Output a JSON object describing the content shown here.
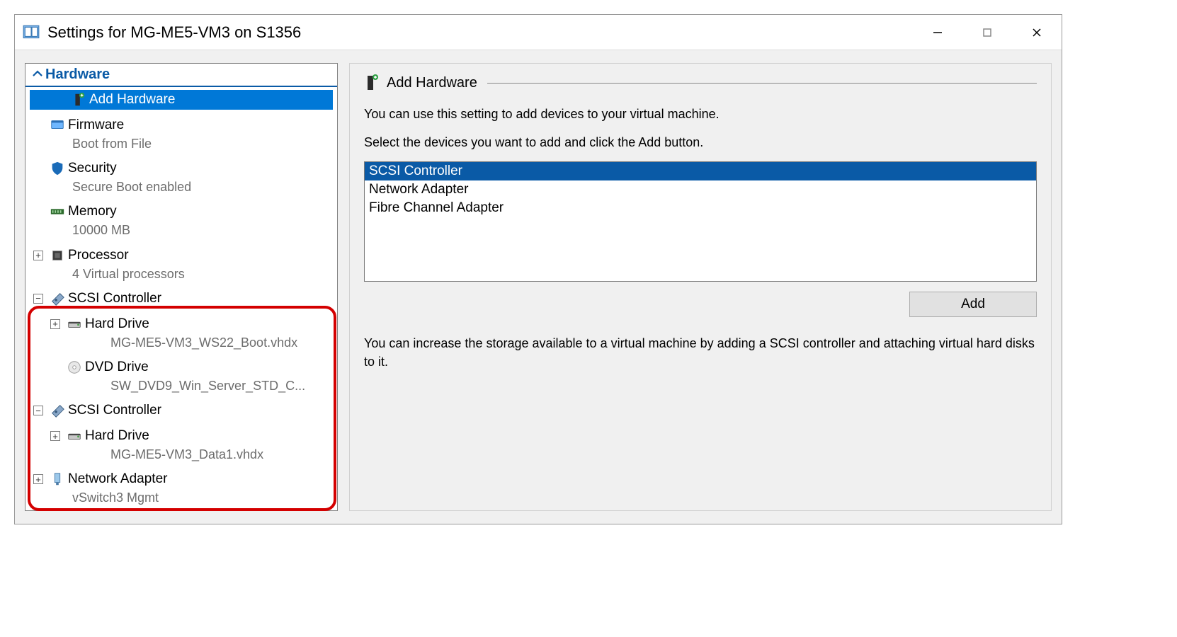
{
  "window": {
    "title": "Settings for MG-ME5-VM3 on S1356"
  },
  "sidebar": {
    "section_label": "Hardware",
    "items": {
      "add_hardware": {
        "label": "Add Hardware"
      },
      "firmware": {
        "label": "Firmware",
        "sub": "Boot from File"
      },
      "security": {
        "label": "Security",
        "sub": "Secure Boot enabled"
      },
      "memory": {
        "label": "Memory",
        "sub": "10000 MB"
      },
      "processor": {
        "label": "Processor",
        "sub": "4 Virtual processors"
      },
      "scsi1": {
        "label": "SCSI Controller"
      },
      "scsi1_hd": {
        "label": "Hard Drive",
        "sub": "MG-ME5-VM3_WS22_Boot.vhdx"
      },
      "scsi1_dvd": {
        "label": "DVD Drive",
        "sub": "SW_DVD9_Win_Server_STD_C..."
      },
      "scsi2": {
        "label": "SCSI Controller"
      },
      "scsi2_hd": {
        "label": "Hard Drive",
        "sub": "MG-ME5-VM3_Data1.vhdx"
      },
      "net": {
        "label": "Network Adapter",
        "sub": "vSwitch3 Mgmt"
      }
    }
  },
  "main": {
    "title": "Add Hardware",
    "desc1": "You can use this setting to add devices to your virtual machine.",
    "desc2": "Select the devices you want to add and click the Add button.",
    "options": {
      "o0": "SCSI Controller",
      "o1": "Network Adapter",
      "o2": "Fibre Channel Adapter"
    },
    "add_button": "Add",
    "desc3": "You can increase the storage available to a virtual machine by adding a SCSI controller and attaching virtual hard disks to it."
  }
}
